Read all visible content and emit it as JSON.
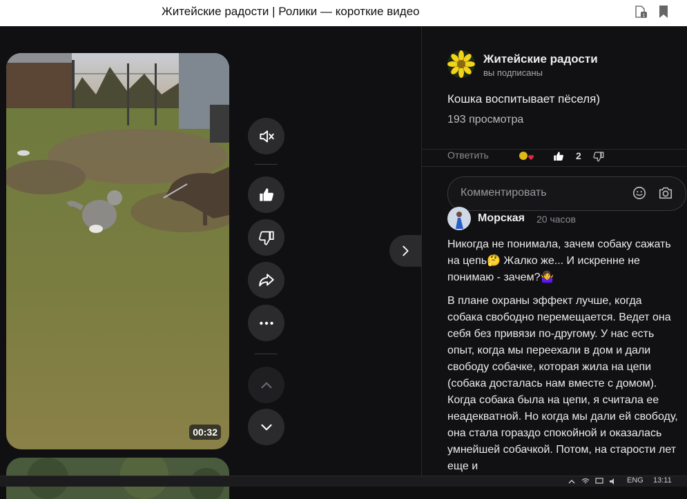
{
  "window": {
    "title": "Житейские радости | Ролики — короткие видео"
  },
  "video": {
    "duration": "00:32",
    "scene": "cat-and-dog-in-yard"
  },
  "actions": [
    {
      "name": "mute-button",
      "icon": "mute-icon"
    },
    {
      "name": "like-button",
      "icon": "thumbs-up-icon"
    },
    {
      "name": "dislike-button",
      "icon": "thumbs-down-icon"
    },
    {
      "name": "share-button",
      "icon": "share-arrow-icon"
    },
    {
      "name": "more-button",
      "icon": "more-dots-icon"
    },
    {
      "name": "prev-video-button",
      "icon": "chevron-up-icon"
    },
    {
      "name": "next-video-button",
      "icon": "chevron-down-icon"
    }
  ],
  "channel": {
    "name": "Житейские радости",
    "subscription_status": "вы подписаны",
    "avatar": "yellow-flower"
  },
  "video_info": {
    "title": "Кошка воспитывает пёселя)",
    "views": "193 просмотра"
  },
  "reply_row": {
    "reply_label": "Ответить",
    "like_count": "2"
  },
  "comment_input": {
    "placeholder": "Комментировать"
  },
  "comment": {
    "author": "Морская",
    "time": "20 часов",
    "paragraphs": [
      "Никогда не понимала, зачем собаку сажать на цепь🤔 Жалко же... И искренне не понимаю - зачем?🤷‍♀️",
      "В плане охраны эффект лучше, когда собака свободно перемещается. Ведет она себя без привязи по-другому. У нас есть опыт, когда мы переехали в дом и дали свободу собачке, которая жила на цепи (собака досталась нам вместе с домом). Когда собака была на цепи, я считала ее неадекватной. Но когда мы дали ей свободу, она стала гораздо спокойной и оказалась умнейшей собачкой. Потом, на старости лет еще и"
    ]
  },
  "taskbar": {
    "lang": "ENG",
    "time": "13:11"
  },
  "colors": {
    "background": "#0f0f10",
    "button": "#2b2b2e",
    "text": "#e8e8e8"
  }
}
